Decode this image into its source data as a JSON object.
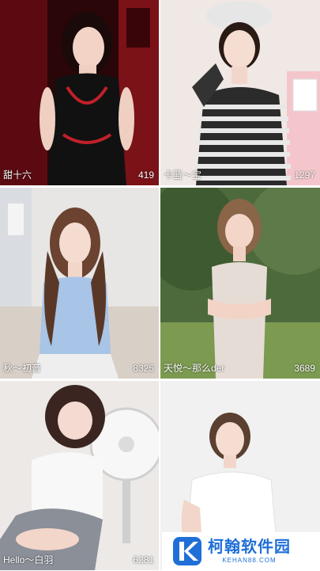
{
  "cards": [
    {
      "name": "甜十六",
      "count": "419"
    },
    {
      "name": "卡蓝～宝",
      "count": "1297"
    },
    {
      "name": "秋～初音",
      "count": "8325"
    },
    {
      "name": "天悦～那么der",
      "count": "3689"
    },
    {
      "name": "Hello～白羽",
      "count": "6281"
    },
    {
      "name": "",
      "count": ""
    }
  ],
  "watermark": {
    "brand": "柯翰软件园",
    "url": "KEHAN88.COM"
  },
  "colors": {
    "watermark_blue": "#1f6fd6"
  }
}
